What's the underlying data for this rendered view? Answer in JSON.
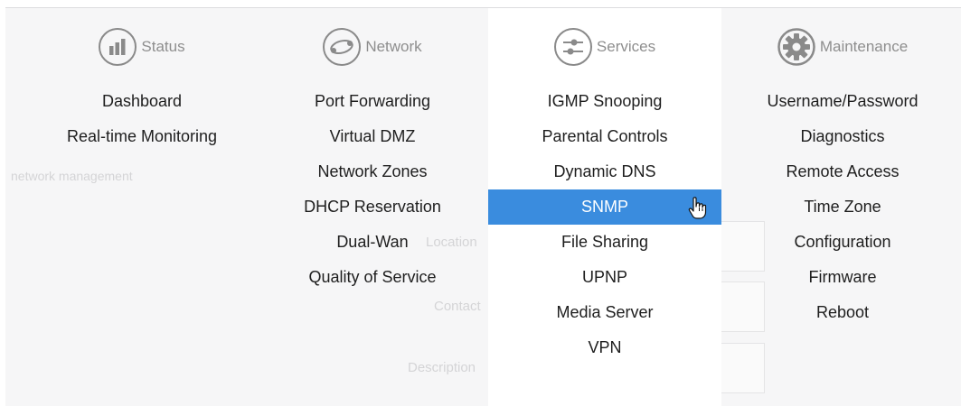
{
  "background_page": {
    "hint_text": "network management",
    "location_label": "Location",
    "contact_label": "Contact",
    "description_label": "Description"
  },
  "menu": {
    "status": {
      "label": "Status",
      "icon": "bar-chart-icon",
      "items": [
        "Dashboard",
        "Real-time Monitoring"
      ]
    },
    "network": {
      "label": "Network",
      "icon": "network-link-icon",
      "items": [
        "Port Forwarding",
        "Virtual DMZ",
        "Network Zones",
        "DHCP Reservation",
        "Dual-Wan",
        "Quality of Service"
      ]
    },
    "services": {
      "label": "Services",
      "icon": "sliders-icon",
      "items": [
        "IGMP Snooping",
        "Parental Controls",
        "Dynamic DNS",
        "SNMP",
        "File Sharing",
        "UPNP",
        "Media Server",
        "VPN"
      ],
      "active_item": "SNMP"
    },
    "maintenance": {
      "label": "Maintenance",
      "icon": "gear-icon",
      "items": [
        "Username/Password",
        "Diagnostics",
        "Remote Access",
        "Time Zone",
        "Configuration",
        "Firmware",
        "Reboot"
      ]
    }
  },
  "colors": {
    "active_bg": "#3a8cde",
    "active_text": "#ffffff",
    "category_gray": "#8e8e8e",
    "background": "#f6f6f7"
  }
}
